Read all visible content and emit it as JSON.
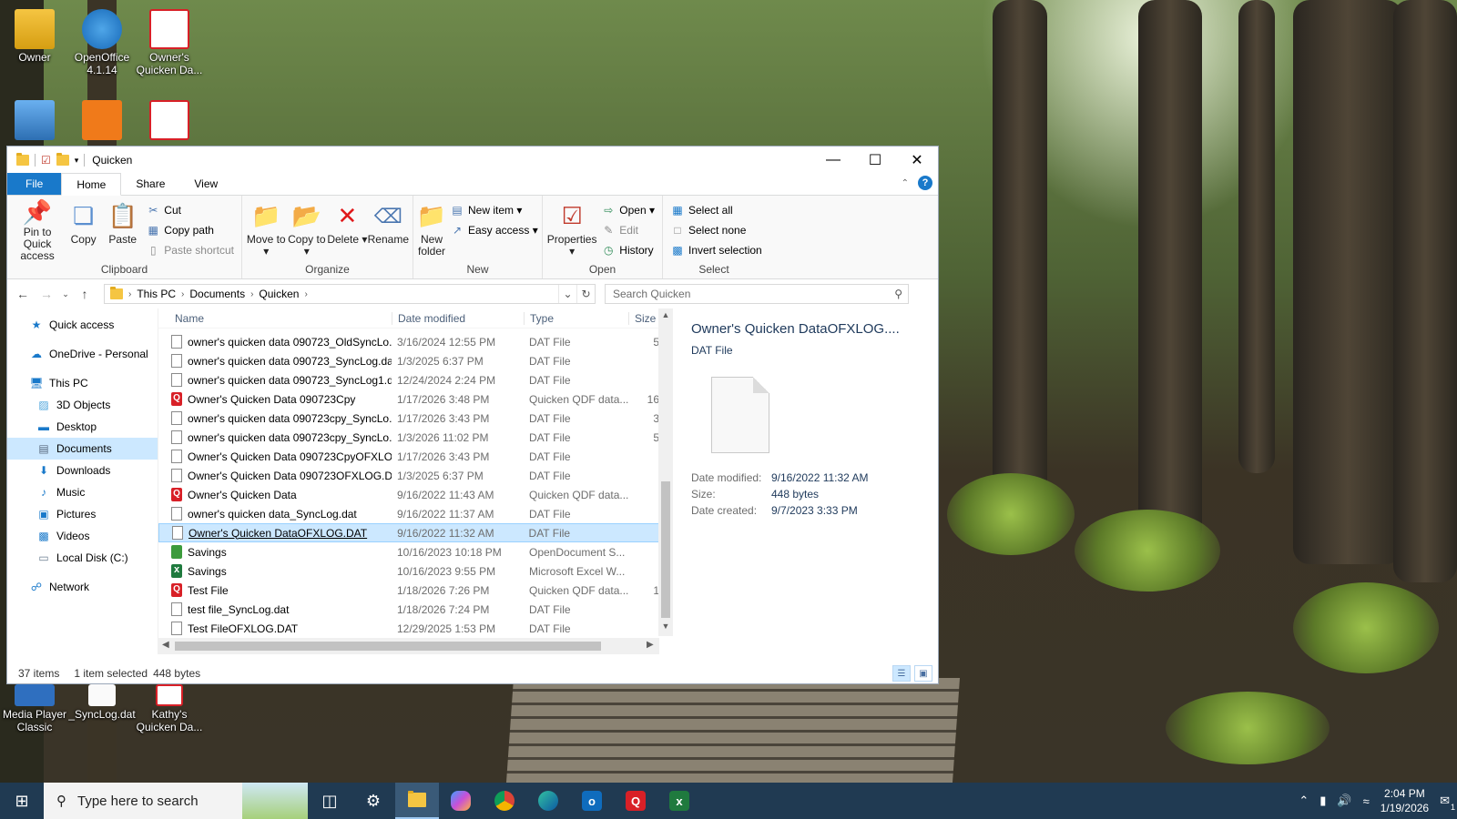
{
  "desktop": {
    "icons_top": [
      {
        "label": "Owner"
      },
      {
        "label": "OpenOffice 4.1.14"
      },
      {
        "label": "Owner's Quicken Da..."
      }
    ],
    "icons_bottom": [
      {
        "label": "Media Player Classic"
      },
      {
        "label": "_SyncLog.dat"
      },
      {
        "label": "Kathy's Quicken Da..."
      }
    ]
  },
  "window": {
    "title": "Quicken",
    "tabs": {
      "file": "File",
      "home": "Home",
      "share": "Share",
      "view": "View"
    },
    "help_label": "?"
  },
  "ribbon": {
    "clipboard": {
      "label": "Clipboard",
      "pin": "Pin to Quick access",
      "copy": "Copy",
      "paste": "Paste",
      "cut": "Cut",
      "copy_path": "Copy path",
      "paste_shortcut": "Paste shortcut"
    },
    "organize": {
      "label": "Organize",
      "move_to": "Move to ▾",
      "copy_to": "Copy to ▾",
      "delete": "Delete ▾",
      "rename": "Rename"
    },
    "new": {
      "label": "New",
      "new_folder": "New folder",
      "new_item": "New item ▾",
      "easy_access": "Easy access ▾"
    },
    "open": {
      "label": "Open",
      "properties": "Properties ▾",
      "open": "Open ▾",
      "edit": "Edit",
      "history": "History"
    },
    "select": {
      "label": "Select",
      "select_all": "Select all",
      "select_none": "Select none",
      "invert": "Invert selection"
    }
  },
  "address": {
    "crumbs": [
      "This PC",
      "Documents",
      "Quicken"
    ],
    "search_placeholder": "Search Quicken"
  },
  "navpane": {
    "items": [
      {
        "label": "Quick access"
      },
      {
        "label": "OneDrive - Personal"
      },
      {
        "label": "This PC"
      },
      {
        "label": "3D Objects"
      },
      {
        "label": "Desktop"
      },
      {
        "label": "Documents"
      },
      {
        "label": "Downloads"
      },
      {
        "label": "Music"
      },
      {
        "label": "Pictures"
      },
      {
        "label": "Videos"
      },
      {
        "label": "Local Disk (C:)"
      },
      {
        "label": "Network"
      }
    ]
  },
  "columns": {
    "name": "Name",
    "date": "Date modified",
    "type": "Type",
    "size": "Size"
  },
  "files": [
    {
      "name": "owner's quicken data 090723_OldSyncLo...",
      "date": "3/16/2024 12:55 PM",
      "type": "DAT File",
      "size": "5",
      "icon": "doc"
    },
    {
      "name": "owner's quicken data 090723_SyncLog.dat",
      "date": "1/3/2025 6:37 PM",
      "type": "DAT File",
      "size": "",
      "icon": "doc"
    },
    {
      "name": "owner's quicken data 090723_SyncLog1.d...",
      "date": "12/24/2024 2:24 PM",
      "type": "DAT File",
      "size": "",
      "icon": "doc"
    },
    {
      "name": "Owner's Quicken Data 090723Cpy",
      "date": "1/17/2026 3:48 PM",
      "type": "Quicken QDF data...",
      "size": "16",
      "icon": "qdf"
    },
    {
      "name": "owner's quicken data 090723cpy_SyncLo...",
      "date": "1/17/2026 3:43 PM",
      "type": "DAT File",
      "size": "3",
      "icon": "doc"
    },
    {
      "name": "owner's quicken data 090723cpy_SyncLo...",
      "date": "1/3/2026 11:02 PM",
      "type": "DAT File",
      "size": "5",
      "icon": "doc"
    },
    {
      "name": "Owner's Quicken Data 090723CpyOFXLO...",
      "date": "1/17/2026 3:43 PM",
      "type": "DAT File",
      "size": "",
      "icon": "doc"
    },
    {
      "name": "Owner's Quicken Data 090723OFXLOG.DAT",
      "date": "1/3/2025 6:37 PM",
      "type": "DAT File",
      "size": "",
      "icon": "doc"
    },
    {
      "name": "Owner's Quicken Data",
      "date": "9/16/2022 11:43 AM",
      "type": "Quicken QDF data...",
      "size": "",
      "icon": "qdf"
    },
    {
      "name": "owner's quicken data_SyncLog.dat",
      "date": "9/16/2022 11:37 AM",
      "type": "DAT File",
      "size": "",
      "icon": "doc"
    },
    {
      "name": "Owner's Quicken DataOFXLOG.DAT",
      "date": "9/16/2022 11:32 AM",
      "type": "DAT File",
      "size": "",
      "icon": "doc",
      "selected": true
    },
    {
      "name": "Savings",
      "date": "10/16/2023 10:18 PM",
      "type": "OpenDocument S...",
      "size": "",
      "icon": "ods"
    },
    {
      "name": "Savings",
      "date": "10/16/2023 9:55 PM",
      "type": "Microsoft Excel W...",
      "size": "",
      "icon": "xls"
    },
    {
      "name": "Test File",
      "date": "1/18/2026 7:26 PM",
      "type": "Quicken QDF data...",
      "size": "1",
      "icon": "qdf"
    },
    {
      "name": "test file_SyncLog.dat",
      "date": "1/18/2026 7:24 PM",
      "type": "DAT File",
      "size": "",
      "icon": "doc"
    },
    {
      "name": "Test FileOFXLOG.DAT",
      "date": "12/29/2025 1:53 PM",
      "type": "DAT File",
      "size": "",
      "icon": "doc"
    }
  ],
  "preview": {
    "title": "Owner's Quicken DataOFXLOG....",
    "type": "DAT File",
    "props": [
      {
        "k": "Date modified:",
        "v": "9/16/2022 11:32 AM"
      },
      {
        "k": "Size:",
        "v": "448 bytes"
      },
      {
        "k": "Date created:",
        "v": "9/7/2023 3:33 PM"
      }
    ]
  },
  "status": {
    "items": "37 items",
    "selected": "1 item selected",
    "size": "448 bytes"
  },
  "taskbar": {
    "search_placeholder": "Type here to search",
    "time": "2:04 PM",
    "date": "1/19/2026",
    "notif_count": "1"
  },
  "colors": {
    "accent": "#1979ca",
    "selection": "#cce8ff",
    "taskbar": "#203a52",
    "quicken_red": "#d82027"
  }
}
